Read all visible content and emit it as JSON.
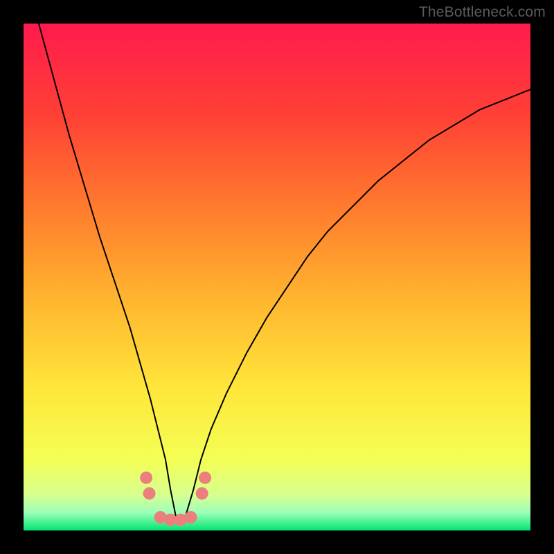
{
  "watermark": "TheBottleneck.com",
  "chart_data": {
    "type": "line",
    "title": "",
    "xlabel": "",
    "ylabel": "",
    "xlim": [
      0,
      100
    ],
    "ylim": [
      0,
      100
    ],
    "grid": false,
    "background_gradient": {
      "direction": "vertical",
      "stops": [
        {
          "pos": 0.0,
          "color": "#ff1a4e"
        },
        {
          "pos": 0.18,
          "color": "#ff4035"
        },
        {
          "pos": 0.36,
          "color": "#ff7a2e"
        },
        {
          "pos": 0.54,
          "color": "#ffb42f"
        },
        {
          "pos": 0.72,
          "color": "#ffe63a"
        },
        {
          "pos": 0.86,
          "color": "#f4ff55"
        },
        {
          "pos": 0.93,
          "color": "#d7ff8f"
        },
        {
          "pos": 0.965,
          "color": "#9cffba"
        },
        {
          "pos": 1.0,
          "color": "#00e571"
        }
      ]
    },
    "minimum_x": 30,
    "series": [
      {
        "name": "curve",
        "stroke": "#000000",
        "stroke_width": 2,
        "x": [
          3,
          6,
          9,
          12,
          15,
          18,
          21,
          23,
          25,
          26.5,
          28,
          29,
          30,
          31,
          32,
          33.5,
          35,
          37,
          40,
          44,
          48,
          52,
          56,
          60,
          65,
          70,
          75,
          80,
          85,
          90,
          95,
          100
        ],
        "y": [
          100,
          89,
          78,
          68,
          58,
          49,
          40,
          33,
          26,
          20,
          14,
          8,
          3,
          2,
          3,
          8,
          14,
          20,
          27,
          35,
          42,
          48,
          54,
          59,
          64,
          69,
          73,
          77,
          80,
          83,
          85,
          87
        ]
      }
    ],
    "markers": {
      "color": "#ec7f7d",
      "radius": 9,
      "points": [
        {
          "x": 24.2,
          "y": 10.4
        },
        {
          "x": 24.8,
          "y": 7.3
        },
        {
          "x": 27.0,
          "y": 2.6
        },
        {
          "x": 29.0,
          "y": 2.1
        },
        {
          "x": 31.0,
          "y": 2.1
        },
        {
          "x": 33.0,
          "y": 2.6
        },
        {
          "x": 35.2,
          "y": 7.3
        },
        {
          "x": 35.8,
          "y": 10.4
        }
      ]
    }
  }
}
